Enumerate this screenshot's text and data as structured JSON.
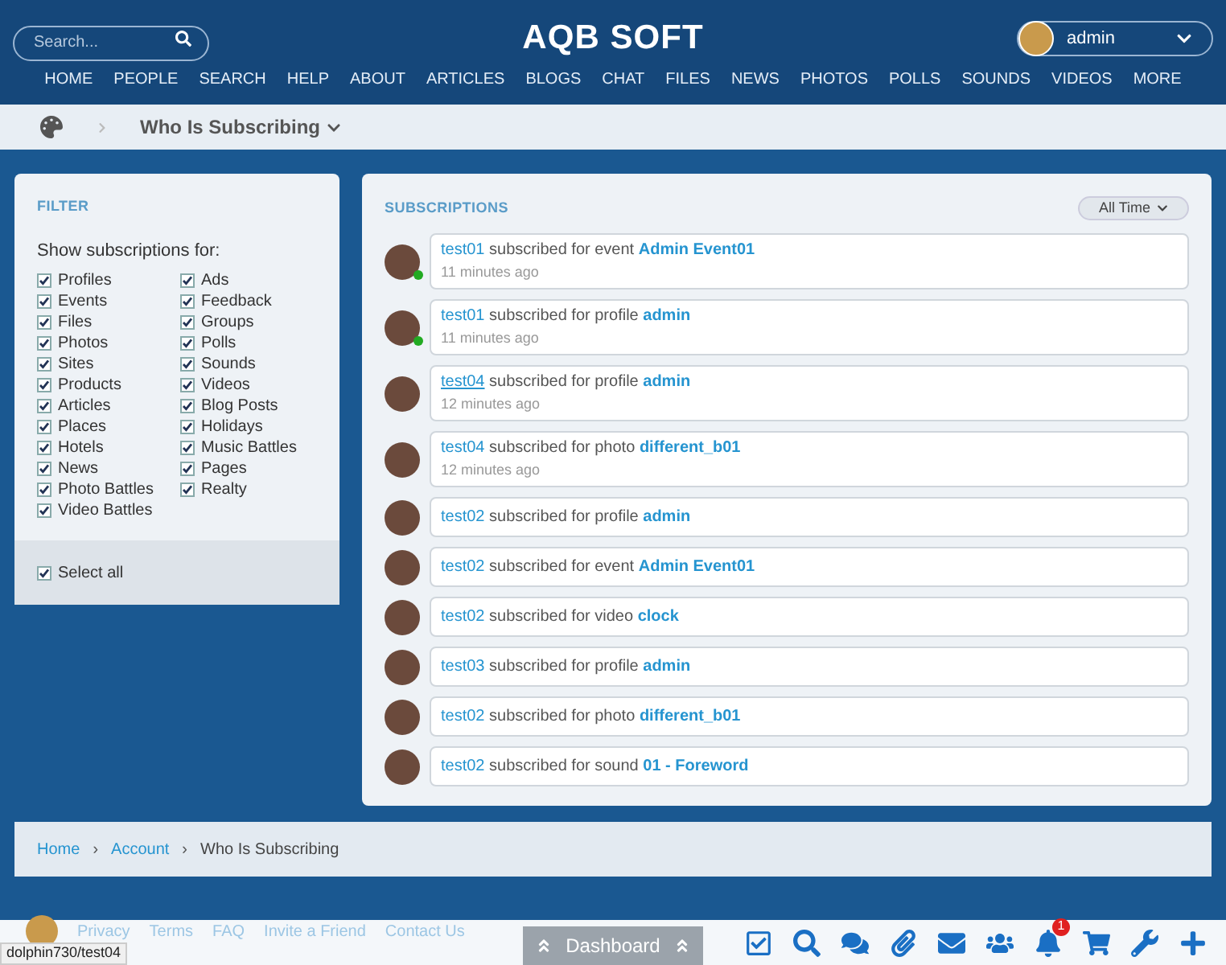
{
  "header": {
    "search": {
      "placeholder": "Search..."
    },
    "logo": "AQB SOFT",
    "user": {
      "name": "admin"
    },
    "nav": [
      "HOME",
      "PEOPLE",
      "SEARCH",
      "HELP",
      "ABOUT",
      "ARTICLES",
      "BLOGS",
      "CHAT",
      "FILES",
      "NEWS",
      "PHOTOS",
      "POLLS",
      "SOUNDS",
      "VIDEOS",
      "MORE"
    ]
  },
  "page_bar": {
    "title": "Who Is Subscribing"
  },
  "filter": {
    "title": "FILTER",
    "label": "Show subscriptions for:",
    "columns": [
      [
        {
          "label": "Profiles",
          "checked": true
        },
        {
          "label": "Events",
          "checked": true
        },
        {
          "label": "Files",
          "checked": true
        },
        {
          "label": "Photos",
          "checked": true
        },
        {
          "label": "Sites",
          "checked": true
        },
        {
          "label": "Products",
          "checked": true
        },
        {
          "label": "Articles",
          "checked": true
        },
        {
          "label": "Places",
          "checked": true
        },
        {
          "label": "Hotels",
          "checked": true
        },
        {
          "label": "News",
          "checked": true
        },
        {
          "label": "Photo Battles",
          "checked": true
        },
        {
          "label": "Video Battles",
          "checked": true
        }
      ],
      [
        {
          "label": "Ads",
          "checked": true
        },
        {
          "label": "Feedback",
          "checked": true
        },
        {
          "label": "Groups",
          "checked": true
        },
        {
          "label": "Polls",
          "checked": true
        },
        {
          "label": "Sounds",
          "checked": true
        },
        {
          "label": "Videos",
          "checked": true
        },
        {
          "label": "Blog Posts",
          "checked": true
        },
        {
          "label": "Holidays",
          "checked": true
        },
        {
          "label": "Music Battles",
          "checked": true
        },
        {
          "label": "Pages",
          "checked": true
        },
        {
          "label": "Realty",
          "checked": true
        }
      ]
    ],
    "select_all": {
      "label": "Select all",
      "checked": true
    }
  },
  "subscriptions": {
    "title": "SUBSCRIPTIONS",
    "period": "All Time",
    "items": [
      {
        "user": "test01",
        "action": "subscribed for event",
        "object": "Admin Event01",
        "time": "11 minutes ago",
        "online": true
      },
      {
        "user": "test01",
        "action": "subscribed for profile",
        "object": "admin",
        "time": "11 minutes ago",
        "online": true
      },
      {
        "user": "test04",
        "action": "subscribed for profile",
        "object": "admin",
        "time": "12 minutes ago",
        "online": false,
        "hovered": true
      },
      {
        "user": "test04",
        "action": "subscribed for photo",
        "object": "different_b01",
        "time": "12 minutes ago",
        "online": false,
        "hovered": false
      },
      {
        "user": "test02",
        "action": "subscribed for profile",
        "object": "admin",
        "online": false
      },
      {
        "user": "test02",
        "action": "subscribed for event",
        "object": "Admin Event01",
        "online": false
      },
      {
        "user": "test02",
        "action": "subscribed for video",
        "object": "clock",
        "online": false
      },
      {
        "user": "test03",
        "action": "subscribed for profile",
        "object": "admin",
        "online": false
      },
      {
        "user": "test02",
        "action": "subscribed for photo",
        "object": "different_b01",
        "online": false
      },
      {
        "user": "test02",
        "action": "subscribed for sound",
        "object": "01 - Foreword",
        "online": false
      }
    ]
  },
  "breadcrumb": {
    "separator": "›",
    "items": [
      {
        "label": "Home",
        "link": true
      },
      {
        "label": "Account",
        "link": true
      },
      {
        "label": "Who Is Subscribing",
        "link": false
      }
    ]
  },
  "footer": {
    "links": [
      "Privacy",
      "Terms",
      "FAQ",
      "Invite a Friend",
      "Contact Us"
    ]
  },
  "dashboard": {
    "label": "Dashboard"
  },
  "toolbar": [
    {
      "kind": "tasks"
    },
    {
      "kind": "search"
    },
    {
      "kind": "chat"
    },
    {
      "kind": "attach"
    },
    {
      "kind": "mail"
    },
    {
      "kind": "users"
    },
    {
      "kind": "bell",
      "badge": "1"
    },
    {
      "kind": "cart"
    },
    {
      "kind": "wrench"
    },
    {
      "kind": "plus"
    }
  ],
  "status_url": "dolphin730/test04"
}
